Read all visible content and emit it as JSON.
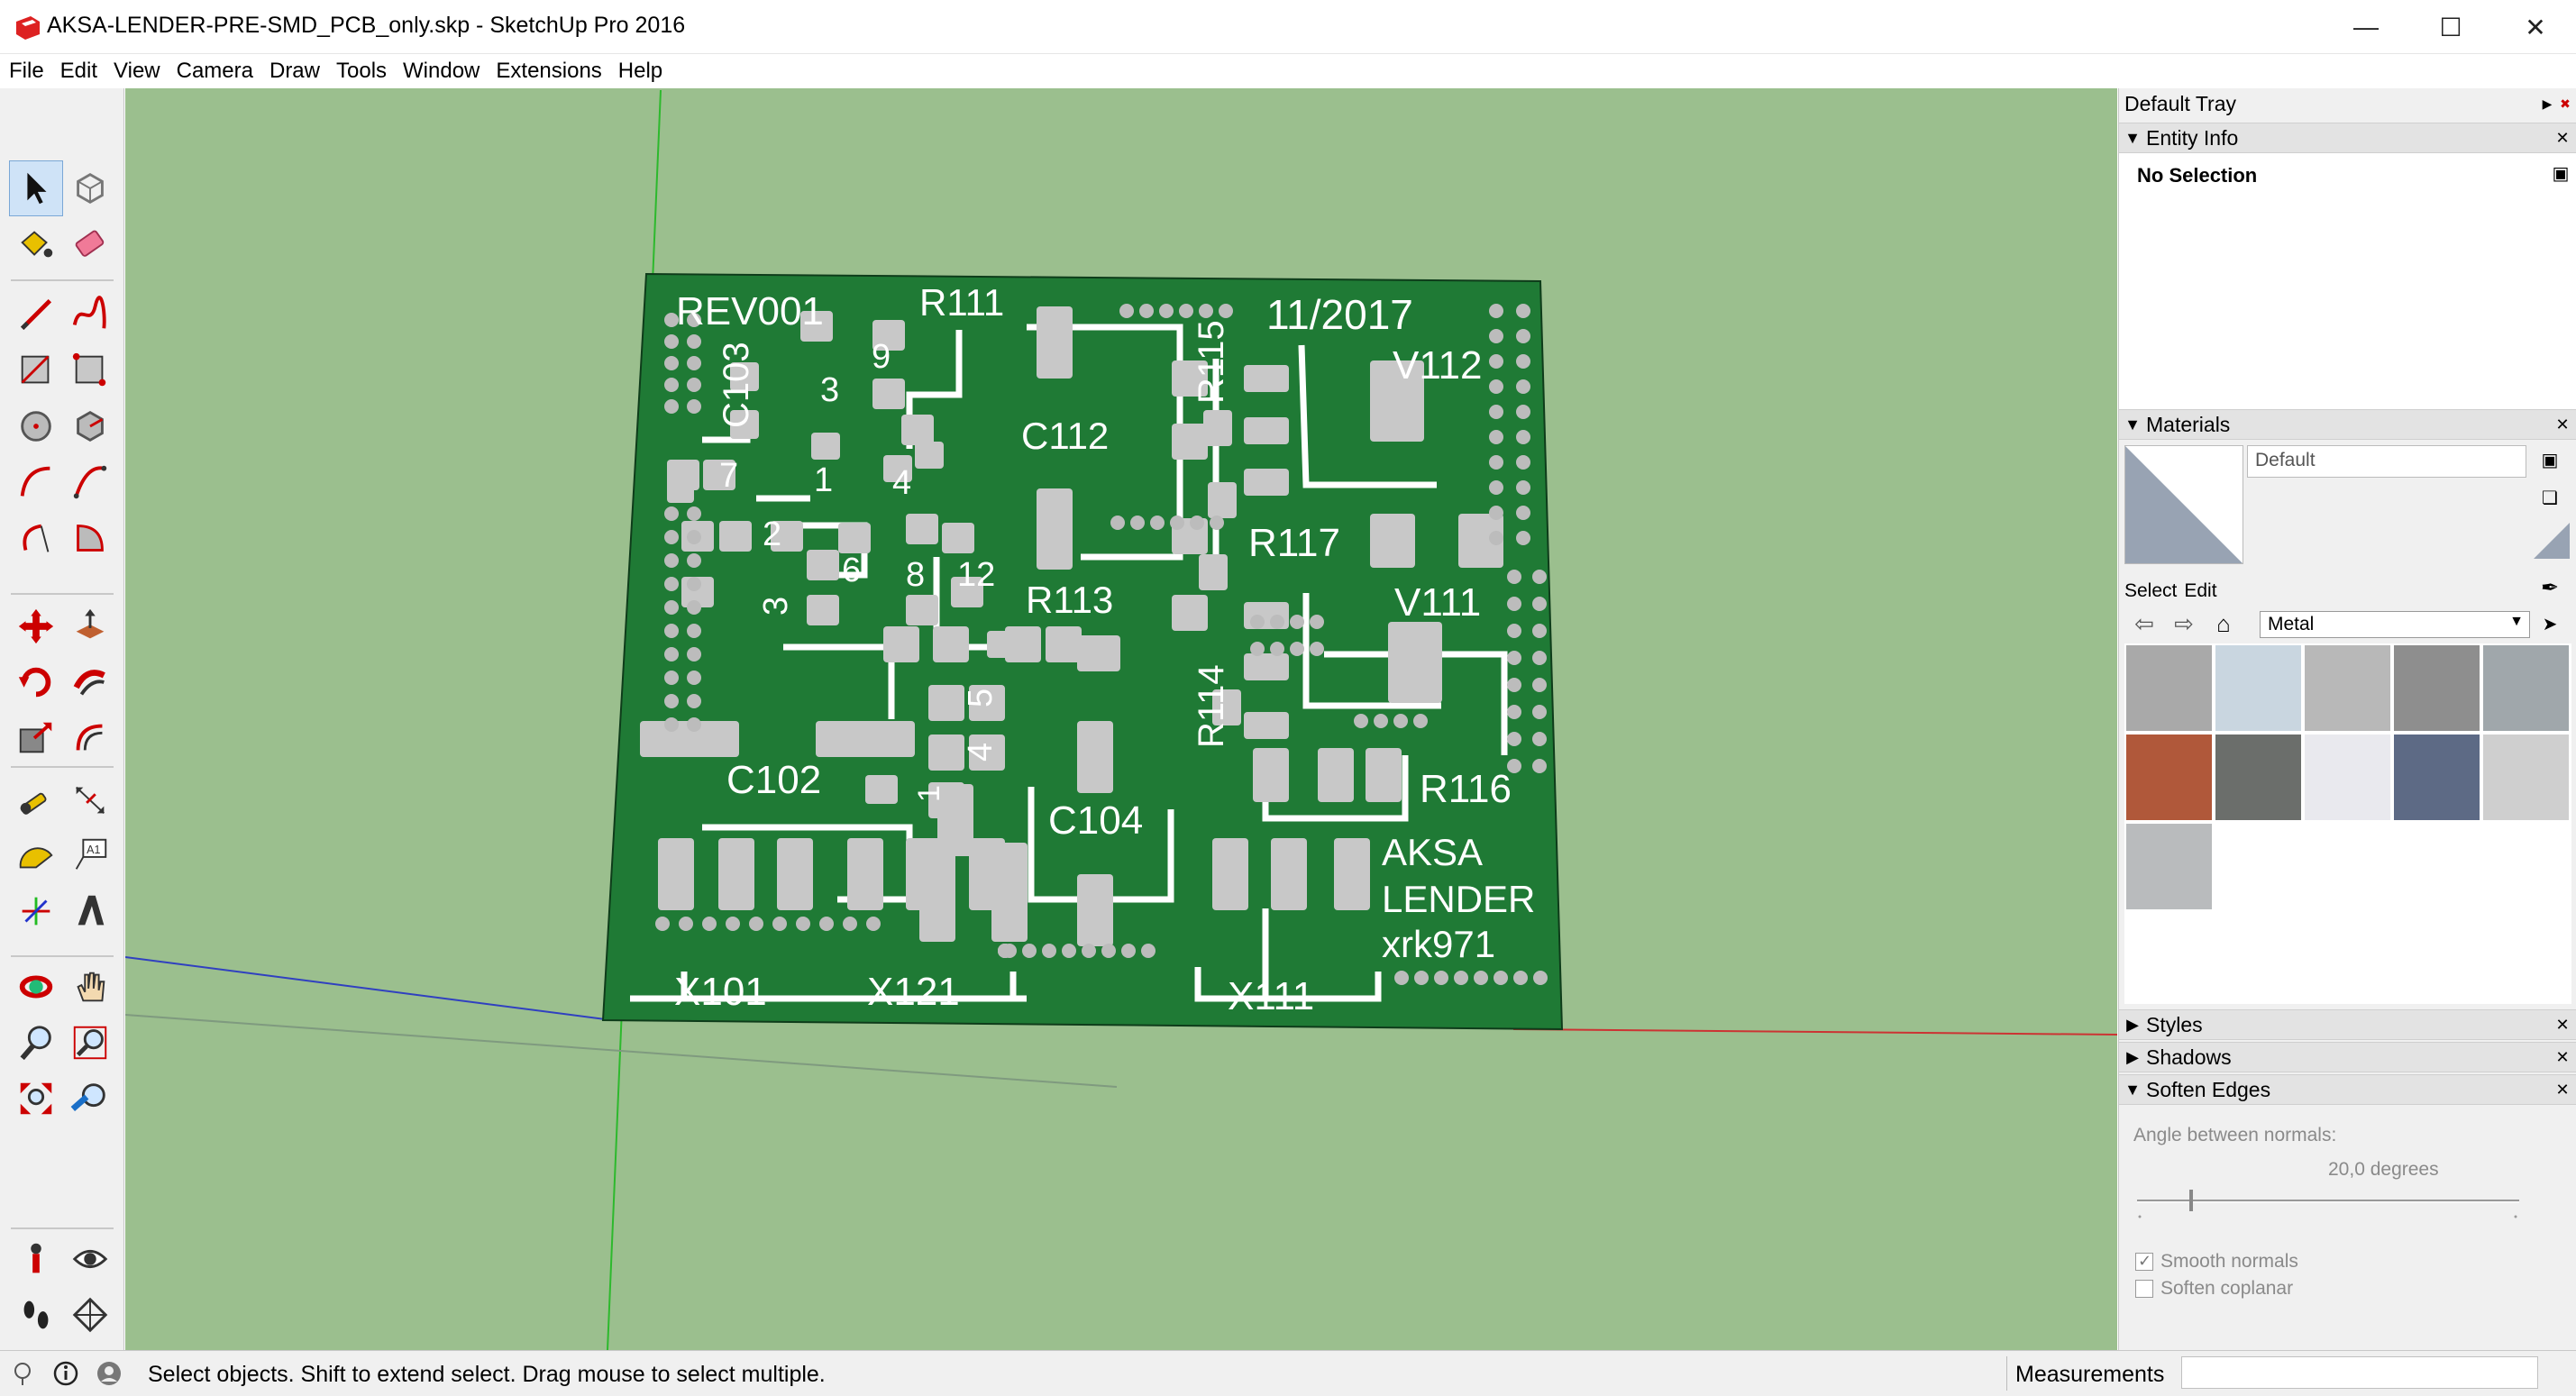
{
  "window": {
    "title": "AKSA-LENDER-PRE-SMD_PCB_only.skp - SketchUp Pro 2016",
    "minimize_glyph": "—",
    "maximize_glyph": "☐",
    "close_glyph": "✕"
  },
  "menu": [
    "File",
    "Edit",
    "View",
    "Camera",
    "Draw",
    "Tools",
    "Window",
    "Extensions",
    "Help"
  ],
  "toolbar": {
    "tools": [
      {
        "name": "select-tool-icon",
        "active": true
      },
      {
        "name": "make-component-icon"
      },
      {
        "name": "paint-bucket-icon"
      },
      {
        "name": "eraser-icon"
      },
      {
        "name": "line-tool-icon"
      },
      {
        "name": "freehand-icon"
      },
      {
        "name": "rectangle-icon"
      },
      {
        "name": "rotated-rectangle-icon"
      },
      {
        "name": "circle-icon"
      },
      {
        "name": "polygon-icon"
      },
      {
        "name": "arc-icon"
      },
      {
        "name": "two-point-arc-icon"
      },
      {
        "name": "three-point-arc-icon"
      },
      {
        "name": "pie-icon"
      },
      {
        "name": "move-icon"
      },
      {
        "name": "push-pull-icon"
      },
      {
        "name": "rotate-icon"
      },
      {
        "name": "follow-me-icon"
      },
      {
        "name": "scale-icon"
      },
      {
        "name": "offset-icon"
      },
      {
        "name": "tape-measure-icon"
      },
      {
        "name": "dimension-icon"
      },
      {
        "name": "protractor-icon"
      },
      {
        "name": "text-icon"
      },
      {
        "name": "axes-icon"
      },
      {
        "name": "3d-text-icon"
      },
      {
        "name": "orbit-icon"
      },
      {
        "name": "pan-icon"
      },
      {
        "name": "zoom-icon"
      },
      {
        "name": "zoom-window-icon"
      },
      {
        "name": "zoom-extents-icon"
      },
      {
        "name": "previous-view-icon"
      },
      {
        "name": "position-camera-icon"
      },
      {
        "name": "look-around-icon"
      },
      {
        "name": "walk-icon"
      },
      {
        "name": "section-plane-icon"
      }
    ]
  },
  "model": {
    "board_color": "#1f7a35",
    "trace_color": "#ffffff",
    "pad_color": "#c8c8c8",
    "labels": [
      "REV001",
      "R111",
      "11/2017",
      "C103",
      "9",
      "3",
      "R115",
      "V112",
      "7",
      "1",
      "4",
      "C112",
      "2",
      "6",
      "8",
      "12",
      "R117",
      "3",
      "R113",
      "V111",
      "5",
      "R114",
      "4",
      "C102",
      "1",
      "R116",
      "C104",
      "AKSA",
      "LENDER",
      "xrk971",
      "X101",
      "X121",
      "X111"
    ]
  },
  "tray": {
    "title": "Default Tray",
    "entity_info": {
      "title": "Entity Info",
      "selection": "No Selection"
    },
    "materials": {
      "title": "Materials",
      "name": "Default",
      "tab_select": "Select",
      "tab_edit": "Edit",
      "library": "Metal",
      "swatch_colors": [
        "#a9a9a9",
        "#c9d6e0",
        "#b8b8b8",
        "#8e8e8e",
        "#a0a7ab",
        "#b0583a",
        "#6b6e6b",
        "#e9e9ee",
        "#5d6a85",
        "#cfcfcf",
        "#b9bbbd"
      ]
    },
    "styles": {
      "title": "Styles"
    },
    "shadows": {
      "title": "Shadows"
    },
    "soften_edges": {
      "title": "Soften Edges",
      "angle_label": "Angle between normals:",
      "angle_value": "20,0  degrees",
      "smooth_normals": "Smooth normals",
      "soften_coplanar": "Soften coplanar",
      "smooth_checked": true,
      "coplanar_checked": false
    }
  },
  "status": {
    "message": "Select objects. Shift to extend select. Drag mouse to select multiple.",
    "measurements_label": "Measurements",
    "measurements_value": ""
  }
}
